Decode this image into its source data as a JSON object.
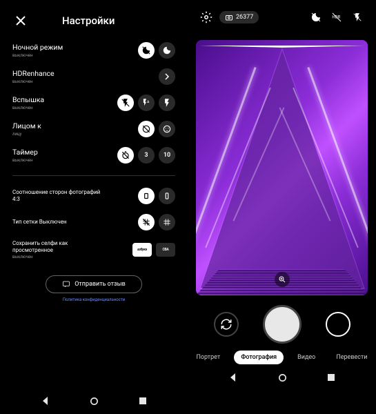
{
  "settings": {
    "title": "Настройки",
    "rows": [
      {
        "label": "Ночной режим",
        "sub": "выключен"
      },
      {
        "label": "HDRenhance",
        "sub": "выключен"
      },
      {
        "label": "Вспышка",
        "sub": "выключен"
      },
      {
        "label": "Лицом к",
        "sub": "лицу"
      },
      {
        "label": "Таймер",
        "sub": "выключен"
      }
    ],
    "timer_opts": [
      "3",
      "10"
    ],
    "aspect": {
      "label": "Соотношение сторон фотографий",
      "value": "4:3"
    },
    "grid": {
      "label": "Тип сетки Выключен"
    },
    "selfie": {
      "label": "Сохранить селфи как просмотренное",
      "sub": "выключен",
      "opts": [
        "азбука",
        "CBA"
      ]
    },
    "feedback": "Отправить отзыв",
    "policy": "Политика конфиденциальности"
  },
  "camera": {
    "counter": "26377",
    "modes": [
      "Портрет",
      "Фотография",
      "Видео",
      "Перевести"
    ],
    "active_mode": 1
  }
}
